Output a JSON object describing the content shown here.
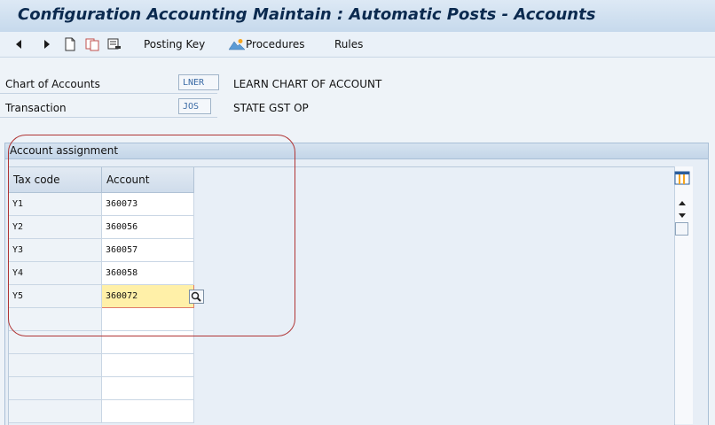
{
  "window": {
    "title": "Configuration Accounting Maintain : Automatic Posts - Accounts"
  },
  "toolbar": {
    "posting_key_label": "Posting Key",
    "procedures_label": "Procedures",
    "rules_label": "Rules"
  },
  "header_fields": [
    {
      "label": "Chart of Accounts",
      "value": "LNER",
      "description": "LEARN CHART OF ACCOUNT"
    },
    {
      "label": "Transaction",
      "value": "JOS",
      "description": "STATE GST OP"
    }
  ],
  "group": {
    "title": "Account assignment"
  },
  "table": {
    "columns": [
      "Tax code",
      "Account"
    ],
    "rows": [
      {
        "tax_code": "Y1",
        "account": "360073"
      },
      {
        "tax_code": "Y2",
        "account": "360056"
      },
      {
        "tax_code": "Y3",
        "account": "360057"
      },
      {
        "tax_code": "Y4",
        "account": "360058"
      },
      {
        "tax_code": "Y5",
        "account": "360072"
      }
    ],
    "selected_row": 4
  },
  "colors": {
    "title_text": "#0b2a4f",
    "highlight_cell": "#fff0a8",
    "annotation": "#b03434"
  }
}
